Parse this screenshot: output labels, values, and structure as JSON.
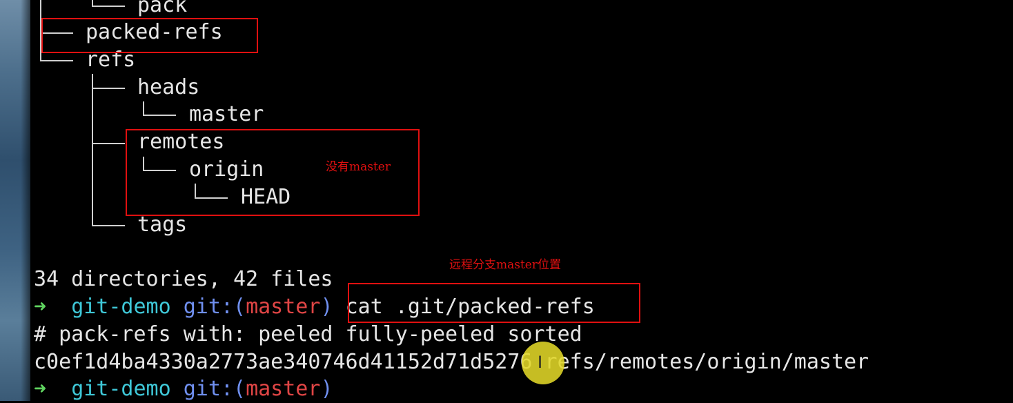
{
  "tree": {
    "pack": "pack",
    "packed_refs": "packed-refs",
    "refs": "refs",
    "heads": "heads",
    "master": "master",
    "remotes": "remotes",
    "origin": "origin",
    "head": "HEAD",
    "tags": "tags"
  },
  "annotations": {
    "no_master": "没有master",
    "remote_master_position": "远程分支master位置"
  },
  "terminal": {
    "summary": "34 directories, 42 files",
    "prompt_arrow": "➜",
    "prompt_dir": "git-demo",
    "prompt_git": "git:(",
    "prompt_branch": "master",
    "prompt_close": ")",
    "command": "cat .git/packed-refs",
    "output_header": "# pack-refs with: peeled fully-peeled sorted",
    "output_ref": "c0ef1d4ba4330a2773ae340746d41152d71d5276 refs/remotes/origin/master"
  },
  "colors": {
    "highlight_box": "#e01010",
    "prompt_arrow": "#5fd35f",
    "prompt_dir": "#3fc8d8",
    "prompt_git": "#7090f0",
    "prompt_branch": "#e04545"
  },
  "cursor": "text-cursor-icon"
}
